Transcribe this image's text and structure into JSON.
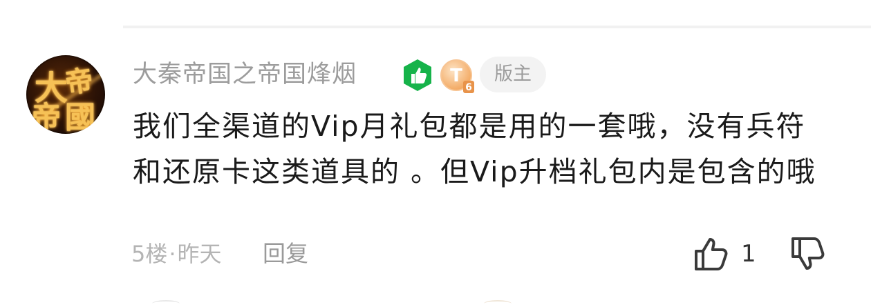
{
  "comment": {
    "username": "大秦帝国之帝国烽烟",
    "role_badge": "版主",
    "level_badge_letter": "T",
    "level_badge_number": "6",
    "body": "我们全渠道的Vip月礼包都是用的一套哦，没有兵符和还原卡这类道具的 。但Vip升档礼包内是包含的哦",
    "floor": "5楼",
    "separator": "·",
    "time": "昨天",
    "reply_label": "回复",
    "like_count": "1",
    "avatar_text": [
      "大",
      "帝",
      "帝",
      "國"
    ]
  },
  "colors": {
    "like_badge_green": "#16b34a",
    "level_badge_orange": "#f2a45a",
    "meta_gray": "#b4b4b4",
    "text_dark": "#1a1a1a"
  },
  "icons": {
    "like_badge": "thumbs-up-icon",
    "like_button": "thumbs-up-outline-icon",
    "dislike_button": "thumbs-down-outline-icon"
  }
}
